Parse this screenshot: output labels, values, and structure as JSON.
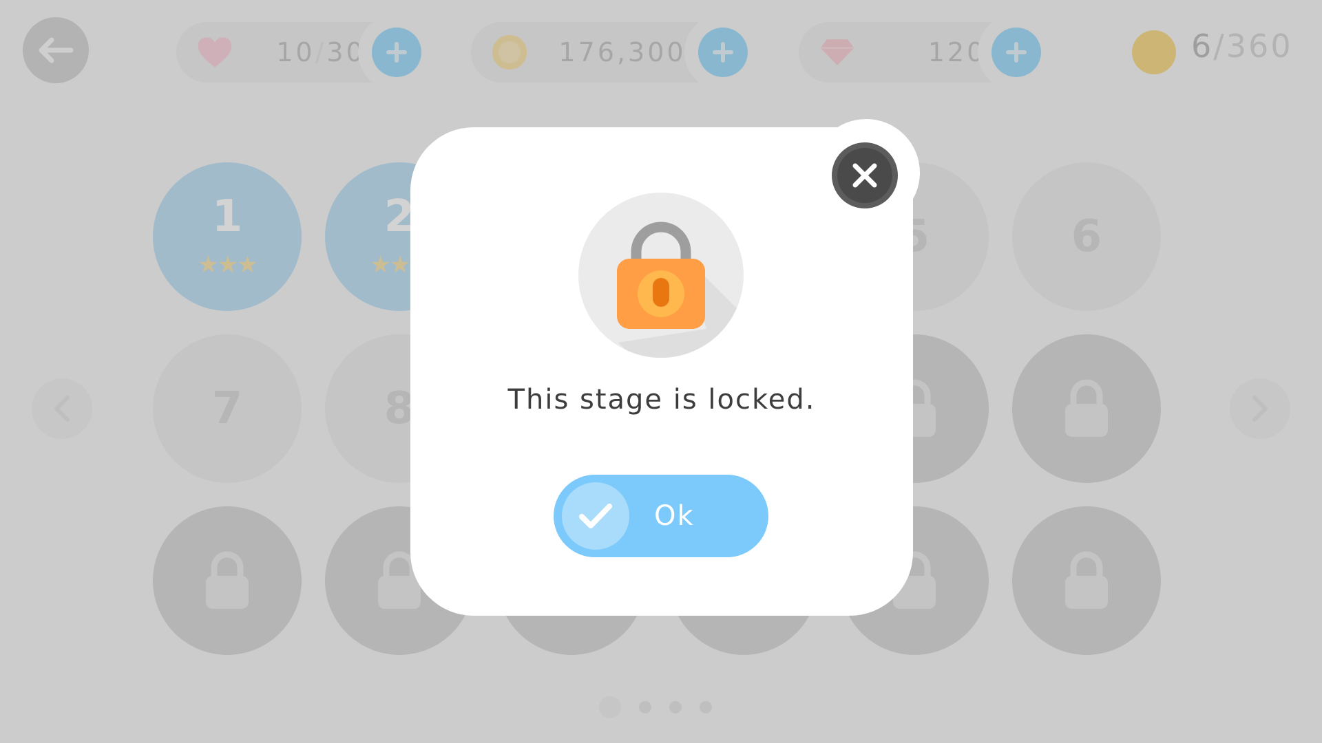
{
  "header": {
    "lives": {
      "icon": "heart-icon",
      "value": "10",
      "separator": "/",
      "max": "30"
    },
    "coins": {
      "icon": "coin-icon",
      "value": "176,300"
    },
    "gems": {
      "icon": "gem-icon",
      "value": "120"
    },
    "stars": {
      "icon": "trophy-icon",
      "value": "6",
      "separator": "/",
      "max": "360"
    }
  },
  "stages": [
    {
      "label": "1",
      "state": "completed",
      "stars": "★★★"
    },
    {
      "label": "2",
      "state": "completed",
      "stars": "★★★"
    },
    {
      "label": "5",
      "state": "open",
      "stars": ""
    },
    {
      "label": "6",
      "state": "open",
      "stars": ""
    },
    {
      "label": "7",
      "state": "open",
      "stars": ""
    },
    {
      "label": "8",
      "state": "open",
      "stars": ""
    }
  ],
  "pagination": {
    "pages": 4,
    "current": 1
  },
  "modal": {
    "icon": "lock-icon",
    "message": "This stage is locked.",
    "ok_label": "Ok",
    "close_icon": "close-icon",
    "check_icon": "checkmark-icon"
  },
  "colors": {
    "accent_blue": "#7ccafc",
    "lock_orange": "#ff9e44",
    "close_dark": "#4a4a4a"
  }
}
